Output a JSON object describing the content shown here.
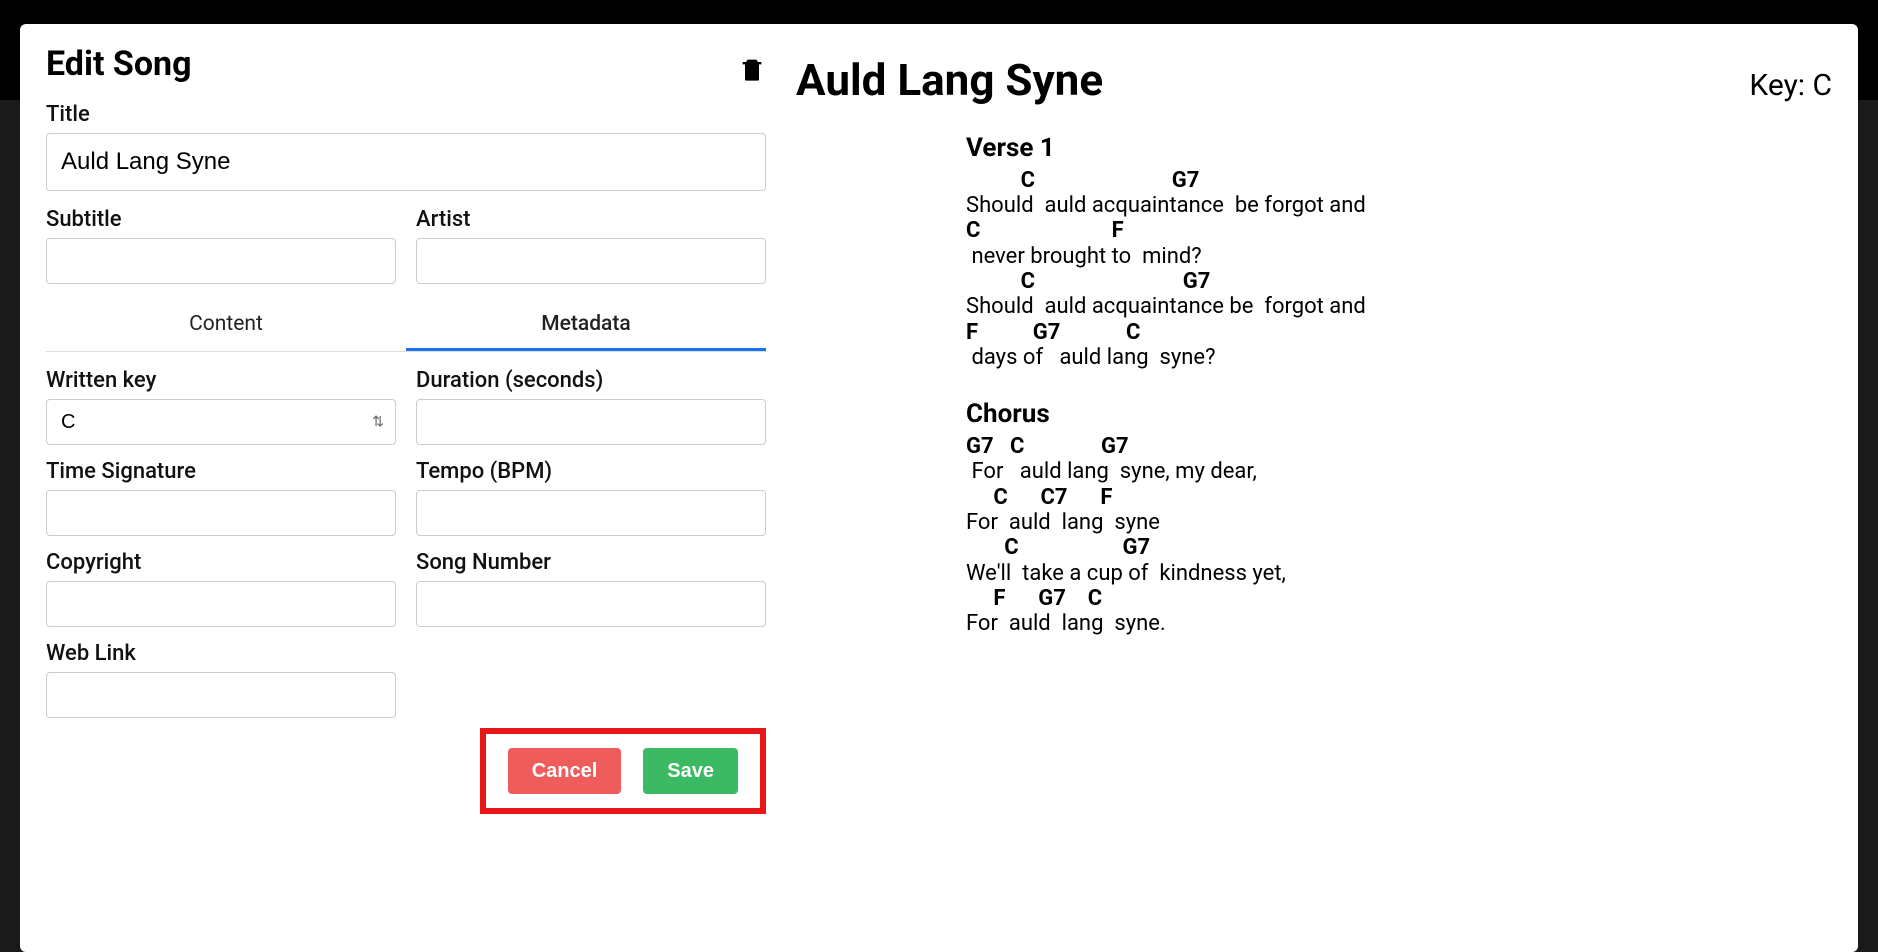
{
  "dialog": {
    "title": "Edit Song",
    "labels": {
      "title": "Title",
      "subtitle": "Subtitle",
      "artist": "Artist",
      "written_key": "Written key",
      "duration": "Duration (seconds)",
      "time_sig": "Time Signature",
      "tempo": "Tempo (BPM)",
      "copyright": "Copyright",
      "song_number": "Song Number",
      "web_link": "Web Link"
    },
    "tabs": {
      "content": "Content",
      "metadata": "Metadata"
    },
    "active_tab": "metadata",
    "buttons": {
      "cancel": "Cancel",
      "save": "Save"
    }
  },
  "form": {
    "title": "Auld Lang Syne",
    "subtitle": "",
    "artist": "",
    "written_key": "C",
    "duration": "",
    "time_sig": "",
    "tempo": "",
    "copyright": "",
    "song_number": "",
    "web_link": ""
  },
  "preview": {
    "title": "Auld Lang Syne",
    "key_label": "Key: C",
    "sections": [
      {
        "name": "Verse 1",
        "lines": [
          {
            "chords": "          C                         G7",
            "lyrics": "Should  auld acquaintance  be forgot and"
          },
          {
            "chords": "C                        F",
            "lyrics": " never brought to  mind?"
          },
          {
            "chords": "          C                           G7",
            "lyrics": "Should  auld acquaintance be  forgot and"
          },
          {
            "chords": "F          G7            C",
            "lyrics": " days of   auld lang  syne?"
          }
        ]
      },
      {
        "name": "Chorus",
        "lines": [
          {
            "chords": "G7   C              G7",
            "lyrics": " For   auld lang  syne, my dear,"
          },
          {
            "chords": "     C      C7      F",
            "lyrics": "For  auld  lang  syne"
          },
          {
            "chords": "       C                   G7",
            "lyrics": "We'll  take a cup of  kindness yet,"
          },
          {
            "chords": "     F      G7    C",
            "lyrics": "For  auld  lang  syne."
          }
        ]
      }
    ]
  }
}
